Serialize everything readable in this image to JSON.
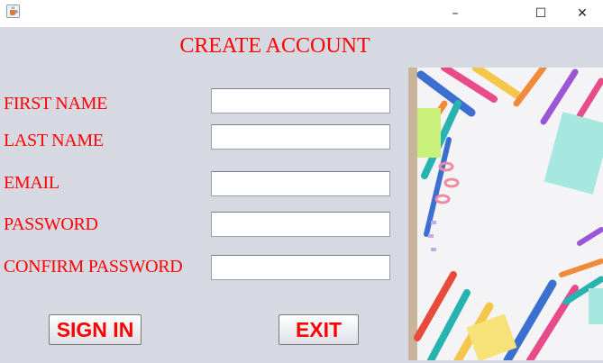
{
  "window": {
    "app_icon": "java-cup-icon",
    "minimize_glyph": "–",
    "maximize_glyph": "☐",
    "close_glyph": "✕"
  },
  "form": {
    "title": "CREATE ACCOUNT",
    "fields": [
      {
        "label": "FIRST NAME",
        "value": "",
        "placeholder": ""
      },
      {
        "label": "LAST NAME",
        "value": "",
        "placeholder": ""
      },
      {
        "label": "EMAIL",
        "value": "",
        "placeholder": ""
      },
      {
        "label": "PASSWORD",
        "value": "",
        "placeholder": ""
      },
      {
        "label": "CONFIRM PASSWORD",
        "value": "",
        "placeholder": ""
      }
    ]
  },
  "buttons": {
    "sign_in": "SIGN IN",
    "exit": "EXIT"
  },
  "image": {
    "icon": "stationery-photo-icon"
  },
  "colors": {
    "label_text": "#ff0000",
    "background": "#d6d9e1",
    "field_bg": "#ffffff"
  }
}
